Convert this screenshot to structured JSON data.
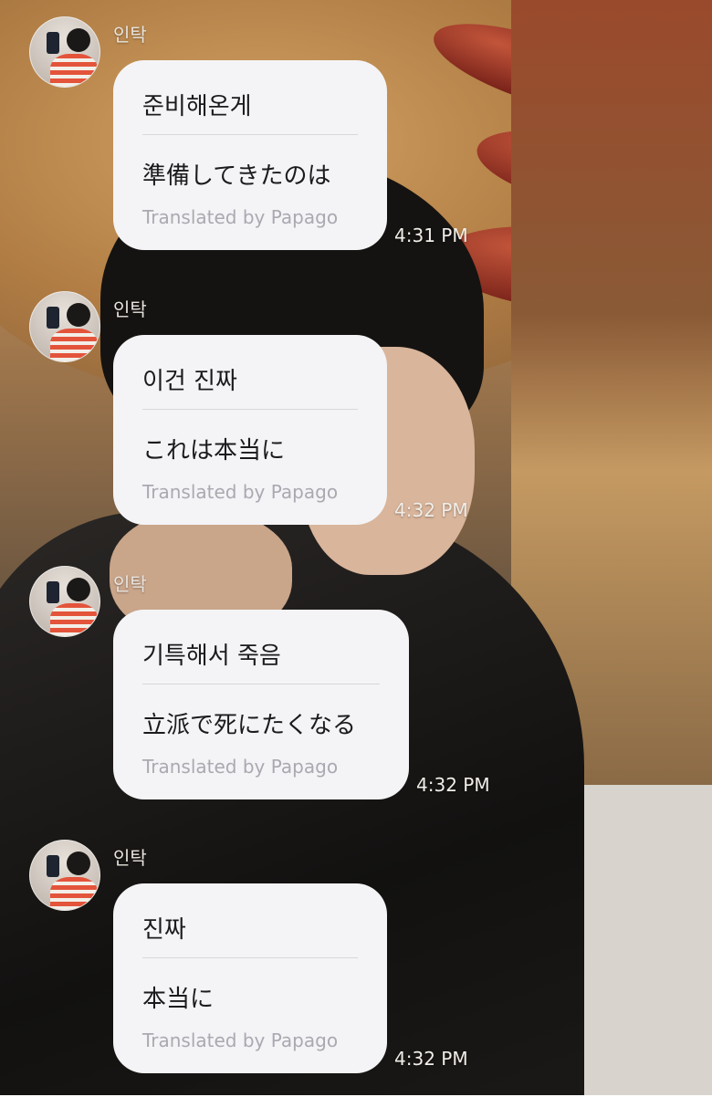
{
  "messages": [
    {
      "sender": "인탁",
      "original": "준비해온게",
      "translation": "準備してきたのは",
      "credit": "Translated by Papago",
      "time": "4:31 PM"
    },
    {
      "sender": "인탁",
      "original": "이건 진짜",
      "translation": "これは本当に",
      "credit": "Translated by Papago",
      "time": "4:32 PM"
    },
    {
      "sender": "인탁",
      "original": "기특해서 죽음",
      "translation": "立派で死にたくなる",
      "credit": "Translated by Papago",
      "time": "4:32 PM"
    },
    {
      "sender": "인탁",
      "original": "진짜",
      "translation": "本当に",
      "credit": "Translated by Papago",
      "time": "4:32 PM"
    }
  ]
}
